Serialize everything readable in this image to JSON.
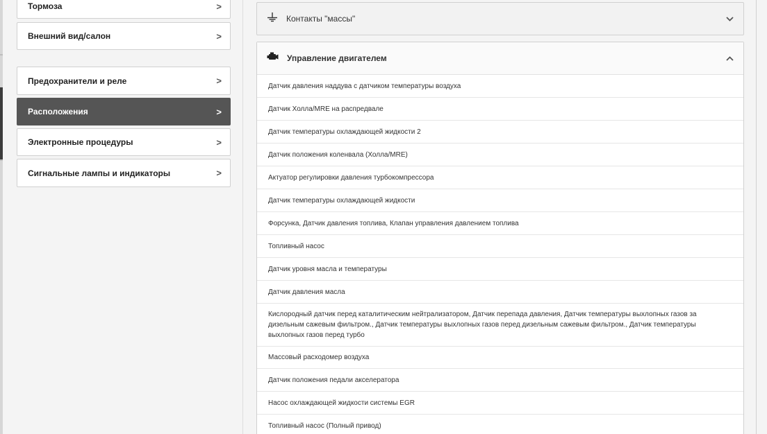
{
  "sidebar": {
    "items": [
      {
        "label": "Тормоза",
        "active": false
      },
      {
        "label": "Внешний вид/салон",
        "active": false
      },
      {
        "label": "Предохранители и реле",
        "active": false
      },
      {
        "label": "Расположения",
        "active": true
      },
      {
        "label": "Электронные процедуры",
        "active": false
      },
      {
        "label": "Сигнальные лампы и индикаторы",
        "active": false
      }
    ],
    "chevron": ">"
  },
  "main": {
    "panels": [
      {
        "title": "Контакты \"массы\"",
        "icon": "ground-icon",
        "expanded": false
      },
      {
        "title": "Управление двигателем",
        "icon": "engine-icon",
        "expanded": true
      }
    ],
    "items": [
      "Датчик давления наддува с датчиком температуры воздуха",
      "Датчик Холла/MRE на распредвале",
      "Датчик температуры охлаждающей жидкости 2",
      "Датчик положения коленвала (Холла/MRE)",
      "Актуатор регулировки давления турбокомпрессора",
      "Датчик температуры охлаждающей жидкости",
      "Форсунка, Датчик давления топлива, Клапан управления давлением топлива",
      "Топливный насос",
      "Датчик уровня масла и температуры",
      "Датчик давления масла",
      "Кислородный датчик перед каталитическим нейтрализатором, Датчик перепада давления, Датчик температуры выхлопных газов за дизельным сажевым фильтром., Датчик температуры выхлопных газов перед дизельным сажевым фильтром., Датчик температуры выхлопных газов перед турбо",
      "Массовый расходомер воздуха",
      "Датчик положения педали акселератора",
      "Насос охлаждающей жидкости системы EGR",
      "Топливный насос (Полный привод)"
    ]
  }
}
